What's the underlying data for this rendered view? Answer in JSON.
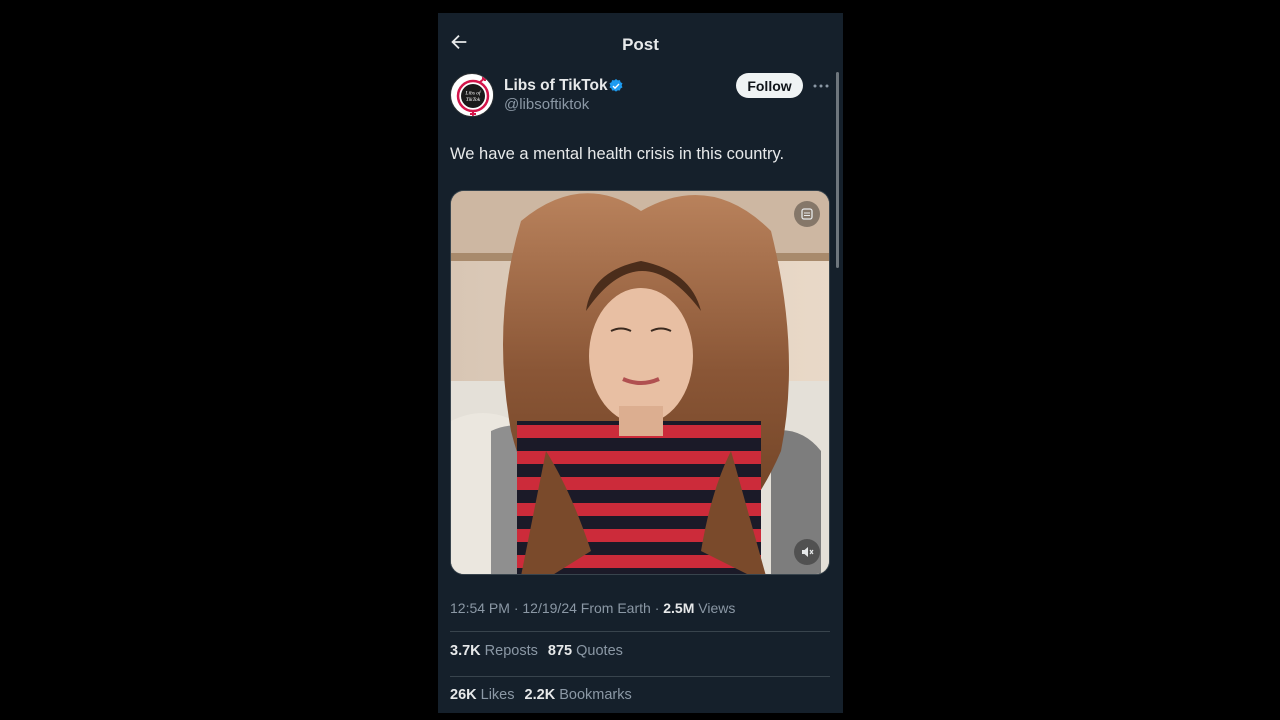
{
  "header": {
    "title": "Post",
    "back_icon": "arrow-left-icon"
  },
  "author": {
    "name": "Libs of TikTok",
    "handle": "@libsoftiktok",
    "avatar_text_line1": "Libs of",
    "avatar_text_line2": "TikTok",
    "verified_color": "#1d9bf0"
  },
  "actions": {
    "follow_label": "Follow",
    "more_icon": "ellipsis-icon"
  },
  "post": {
    "text": "We have a mental health crisis in this country.",
    "media_type": "video"
  },
  "meta": {
    "time": "12:54 PM",
    "date": "12/19/24",
    "location": "From Earth",
    "views_count": "2.5M",
    "views_label": "Views"
  },
  "stats": {
    "reposts_count": "3.7K",
    "reposts_label": "Reposts",
    "quotes_count": "875",
    "quotes_label": "Quotes",
    "likes_count": "26K",
    "likes_label": "Likes",
    "bookmarks_count": "2.2K",
    "bookmarks_label": "Bookmarks"
  },
  "colors": {
    "background": "#15202b",
    "text": "#e7e9ea",
    "muted": "#8b98a5",
    "border": "#38444d"
  }
}
